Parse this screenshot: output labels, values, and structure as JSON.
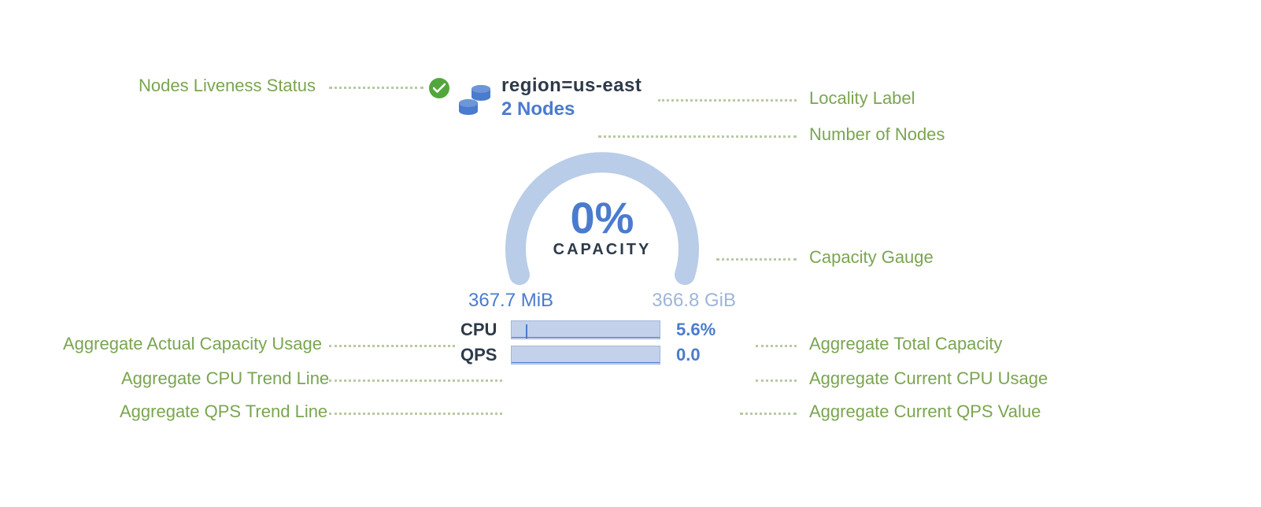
{
  "annotations": {
    "liveness": "Nodes Liveness Status",
    "locality": "Locality Label",
    "nodes": "Number of Nodes",
    "gauge": "Capacity Gauge",
    "used": "Aggregate Actual Capacity Usage",
    "total": "Aggregate Total Capacity",
    "cpu_line": "Aggregate CPU Trend Line",
    "cpu_val": "Aggregate Current CPU Usage",
    "qps_line": "Aggregate QPS Trend Line",
    "qps_val": "Aggregate Current QPS Value"
  },
  "card": {
    "locality_text": "region=us-east",
    "nodes_text": "2 Nodes",
    "gauge_pct": "0%",
    "gauge_label": "CAPACITY",
    "used": "367.7 MiB",
    "total": "366.8 GiB",
    "cpu_label": "CPU",
    "cpu_value": "5.6%",
    "qps_label": "QPS",
    "qps_value": "0.0"
  },
  "chart_data": {
    "type": "table",
    "title": "Cluster locality summary card (region=us-east)",
    "rows": [
      {
        "metric": "Nodes liveness",
        "value": "healthy"
      },
      {
        "metric": "Locality",
        "value": "region=us-east"
      },
      {
        "metric": "Node count",
        "value": 2
      },
      {
        "metric": "Capacity used (%)",
        "value": 0
      },
      {
        "metric": "Capacity used",
        "value": "367.7 MiB"
      },
      {
        "metric": "Capacity total",
        "value": "366.8 GiB"
      },
      {
        "metric": "CPU usage (%)",
        "value": 5.6
      },
      {
        "metric": "QPS",
        "value": 0.0
      }
    ],
    "gauge": {
      "type": "gauge",
      "value": 0,
      "min": 0,
      "max": 100,
      "label": "CAPACITY"
    }
  }
}
